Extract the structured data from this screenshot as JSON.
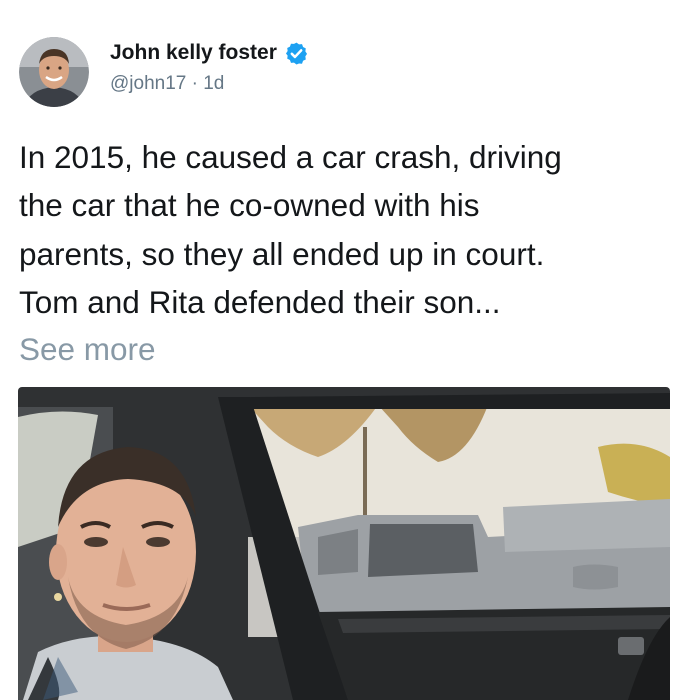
{
  "author": {
    "name": "John kelly foster",
    "handle": "@john17",
    "separator": "·",
    "time": "1d",
    "verified_icon": "verified-badge-icon",
    "verified_color": "#1da1f2",
    "avatar_icon": "avatar-photo"
  },
  "tweet": {
    "text": "In 2015, he caused a car crash, driving\nthe car that he co-owned with his\nparents, so they all ended up in court.\nTom and Rita defended their son...",
    "see_more": "See more"
  },
  "media": {
    "icon": "photo-man-in-car"
  },
  "colors": {
    "text": "#14171a",
    "secondary": "#657786",
    "see_more": "#8899a6"
  }
}
